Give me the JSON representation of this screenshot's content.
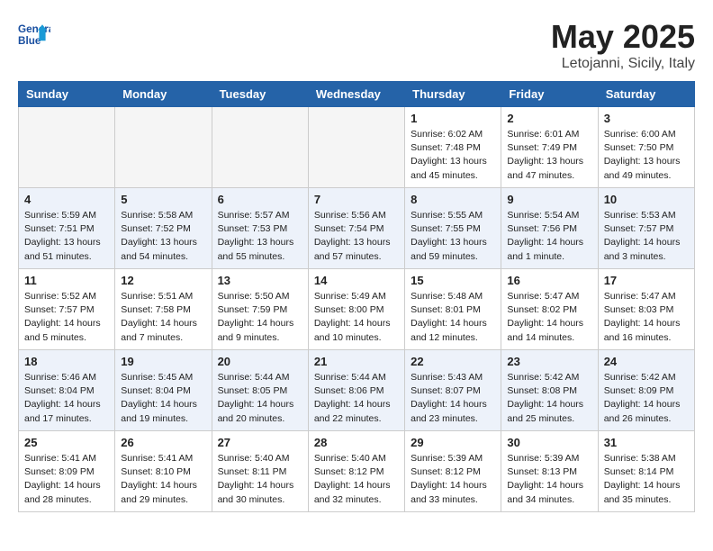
{
  "header": {
    "logo_line1": "General",
    "logo_line2": "Blue",
    "month": "May 2025",
    "location": "Letojanni, Sicily, Italy"
  },
  "days_of_week": [
    "Sunday",
    "Monday",
    "Tuesday",
    "Wednesday",
    "Thursday",
    "Friday",
    "Saturday"
  ],
  "weeks": [
    [
      {
        "day": "",
        "empty": true
      },
      {
        "day": "",
        "empty": true
      },
      {
        "day": "",
        "empty": true
      },
      {
        "day": "",
        "empty": true
      },
      {
        "day": "1",
        "sunrise": "6:02 AM",
        "sunset": "7:48 PM",
        "daylight": "13 hours and 45 minutes."
      },
      {
        "day": "2",
        "sunrise": "6:01 AM",
        "sunset": "7:49 PM",
        "daylight": "13 hours and 47 minutes."
      },
      {
        "day": "3",
        "sunrise": "6:00 AM",
        "sunset": "7:50 PM",
        "daylight": "13 hours and 49 minutes."
      }
    ],
    [
      {
        "day": "4",
        "sunrise": "5:59 AM",
        "sunset": "7:51 PM",
        "daylight": "13 hours and 51 minutes."
      },
      {
        "day": "5",
        "sunrise": "5:58 AM",
        "sunset": "7:52 PM",
        "daylight": "13 hours and 54 minutes."
      },
      {
        "day": "6",
        "sunrise": "5:57 AM",
        "sunset": "7:53 PM",
        "daylight": "13 hours and 55 minutes."
      },
      {
        "day": "7",
        "sunrise": "5:56 AM",
        "sunset": "7:54 PM",
        "daylight": "13 hours and 57 minutes."
      },
      {
        "day": "8",
        "sunrise": "5:55 AM",
        "sunset": "7:55 PM",
        "daylight": "13 hours and 59 minutes."
      },
      {
        "day": "9",
        "sunrise": "5:54 AM",
        "sunset": "7:56 PM",
        "daylight": "14 hours and 1 minute."
      },
      {
        "day": "10",
        "sunrise": "5:53 AM",
        "sunset": "7:57 PM",
        "daylight": "14 hours and 3 minutes."
      }
    ],
    [
      {
        "day": "11",
        "sunrise": "5:52 AM",
        "sunset": "7:57 PM",
        "daylight": "14 hours and 5 minutes."
      },
      {
        "day": "12",
        "sunrise": "5:51 AM",
        "sunset": "7:58 PM",
        "daylight": "14 hours and 7 minutes."
      },
      {
        "day": "13",
        "sunrise": "5:50 AM",
        "sunset": "7:59 PM",
        "daylight": "14 hours and 9 minutes."
      },
      {
        "day": "14",
        "sunrise": "5:49 AM",
        "sunset": "8:00 PM",
        "daylight": "14 hours and 10 minutes."
      },
      {
        "day": "15",
        "sunrise": "5:48 AM",
        "sunset": "8:01 PM",
        "daylight": "14 hours and 12 minutes."
      },
      {
        "day": "16",
        "sunrise": "5:47 AM",
        "sunset": "8:02 PM",
        "daylight": "14 hours and 14 minutes."
      },
      {
        "day": "17",
        "sunrise": "5:47 AM",
        "sunset": "8:03 PM",
        "daylight": "14 hours and 16 minutes."
      }
    ],
    [
      {
        "day": "18",
        "sunrise": "5:46 AM",
        "sunset": "8:04 PM",
        "daylight": "14 hours and 17 minutes."
      },
      {
        "day": "19",
        "sunrise": "5:45 AM",
        "sunset": "8:04 PM",
        "daylight": "14 hours and 19 minutes."
      },
      {
        "day": "20",
        "sunrise": "5:44 AM",
        "sunset": "8:05 PM",
        "daylight": "14 hours and 20 minutes."
      },
      {
        "day": "21",
        "sunrise": "5:44 AM",
        "sunset": "8:06 PM",
        "daylight": "14 hours and 22 minutes."
      },
      {
        "day": "22",
        "sunrise": "5:43 AM",
        "sunset": "8:07 PM",
        "daylight": "14 hours and 23 minutes."
      },
      {
        "day": "23",
        "sunrise": "5:42 AM",
        "sunset": "8:08 PM",
        "daylight": "14 hours and 25 minutes."
      },
      {
        "day": "24",
        "sunrise": "5:42 AM",
        "sunset": "8:09 PM",
        "daylight": "14 hours and 26 minutes."
      }
    ],
    [
      {
        "day": "25",
        "sunrise": "5:41 AM",
        "sunset": "8:09 PM",
        "daylight": "14 hours and 28 minutes."
      },
      {
        "day": "26",
        "sunrise": "5:41 AM",
        "sunset": "8:10 PM",
        "daylight": "14 hours and 29 minutes."
      },
      {
        "day": "27",
        "sunrise": "5:40 AM",
        "sunset": "8:11 PM",
        "daylight": "14 hours and 30 minutes."
      },
      {
        "day": "28",
        "sunrise": "5:40 AM",
        "sunset": "8:12 PM",
        "daylight": "14 hours and 32 minutes."
      },
      {
        "day": "29",
        "sunrise": "5:39 AM",
        "sunset": "8:12 PM",
        "daylight": "14 hours and 33 minutes."
      },
      {
        "day": "30",
        "sunrise": "5:39 AM",
        "sunset": "8:13 PM",
        "daylight": "14 hours and 34 minutes."
      },
      {
        "day": "31",
        "sunrise": "5:38 AM",
        "sunset": "8:14 PM",
        "daylight": "14 hours and 35 minutes."
      }
    ]
  ]
}
